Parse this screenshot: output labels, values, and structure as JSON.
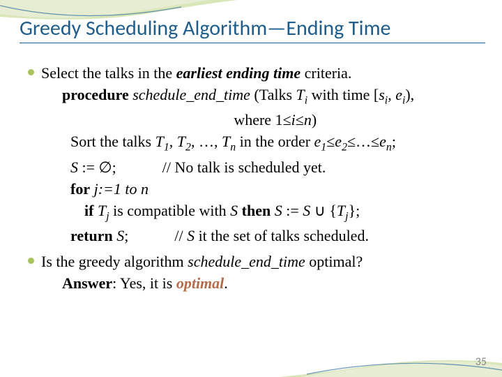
{
  "title": "Greedy Scheduling Algorithm—Ending Time",
  "bullets": [
    {
      "lead": "Select the talks in the ",
      "emph": "earliest ending time",
      "tail": " criteria.",
      "proc": {
        "procWord": "procedure",
        "procName": " schedule_end_time",
        "procArgs1": " (Talks ",
        "procT": "T",
        "procIsub": "i",
        "procArgs2": " with time [",
        "proc_s": "s",
        "procComma": ", ",
        "proc_e": "e",
        "procArgs3": "),",
        "whereLine": "where 1≤",
        "where_i": "i",
        "whereTail": "≤",
        "where_n": "n",
        "whereClose": ")",
        "sort1": "Sort the talks ",
        "sortT": "T",
        "one": "1",
        "sortComma": ", ",
        "two": "2",
        "dots": ", …, ",
        "n": "n",
        "sortOrder": " in the order ",
        "sort_e": "e",
        "leq": "≤",
        "ellip": "≤…≤",
        "semi": ";",
        "sInit": "S",
        "assign": " := ∅;",
        "comment1": "// No talk is scheduled yet.",
        "forWord": "for",
        "forBody": " j:=1 to ",
        "ifWord": "if",
        "ifT": " T",
        "jsub": "j",
        "ifMid": " is compatible with ",
        "S": "S",
        "thenWord": " then ",
        "setUpd1": " := ",
        "cup": " ∪ {",
        "close": "};",
        "returnWord": "return",
        "retS": " S",
        "retSemi": ";",
        "comment2a": "// ",
        "comment2b": " it the set of talks scheduled."
      }
    },
    {
      "q1": "Is the greedy algorithm ",
      "qname": "schedule_end_time",
      "q2": " optimal?",
      "ansLabel": "Answer",
      "ansMid": ": Yes, it is ",
      "ansWord": "optimal",
      "ansDot": "."
    }
  ],
  "pageNumber": "35"
}
